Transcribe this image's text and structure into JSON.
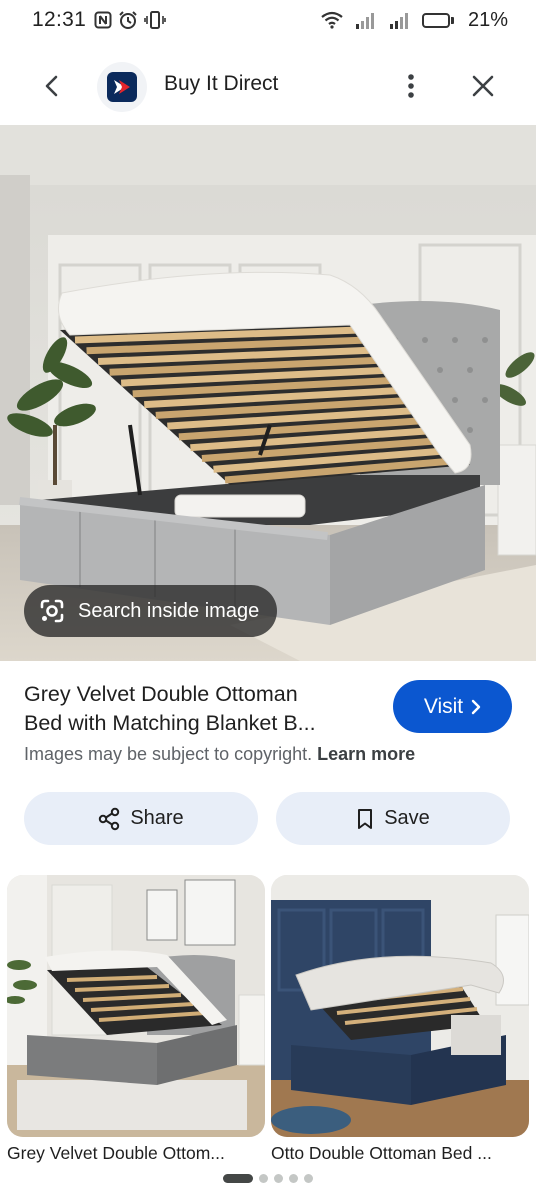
{
  "status_bar": {
    "time": "12:31",
    "battery_percent": "21%",
    "battery_level": 0.21,
    "icons": [
      "nfc-icon",
      "alarm-icon",
      "vibrate-icon",
      "wifi-icon",
      "signal-icon",
      "signal-icon",
      "battery-icon"
    ]
  },
  "header": {
    "back_icon": "chevron-left-icon",
    "site_name": "Buy It Direct",
    "more_icon": "more-vert-icon",
    "close_icon": "close-icon"
  },
  "main_image": {
    "alt": "Grey velvet ottoman bed with lifted storage base",
    "search_inside_label": "Search inside image"
  },
  "product": {
    "title_line1": "Grey Velvet Double Ottoman",
    "title_line2": "Bed with Matching Blanket B...",
    "visit_label": "Visit",
    "copyright_text": "Images may be subject to copyright.",
    "learn_more": "Learn more"
  },
  "actions": {
    "share_label": "Share",
    "save_label": "Save"
  },
  "related": [
    {
      "caption": "Grey Velvet Double Ottom..."
    },
    {
      "caption": "Otto Double Ottoman Bed ..."
    }
  ],
  "colors": {
    "accent": "#0b57d0",
    "action_bg": "#e8eef8",
    "brand_navy": "#0b2a5c",
    "brand_red": "#e4252c"
  },
  "pagination": {
    "count": 5,
    "active_index": 0
  }
}
